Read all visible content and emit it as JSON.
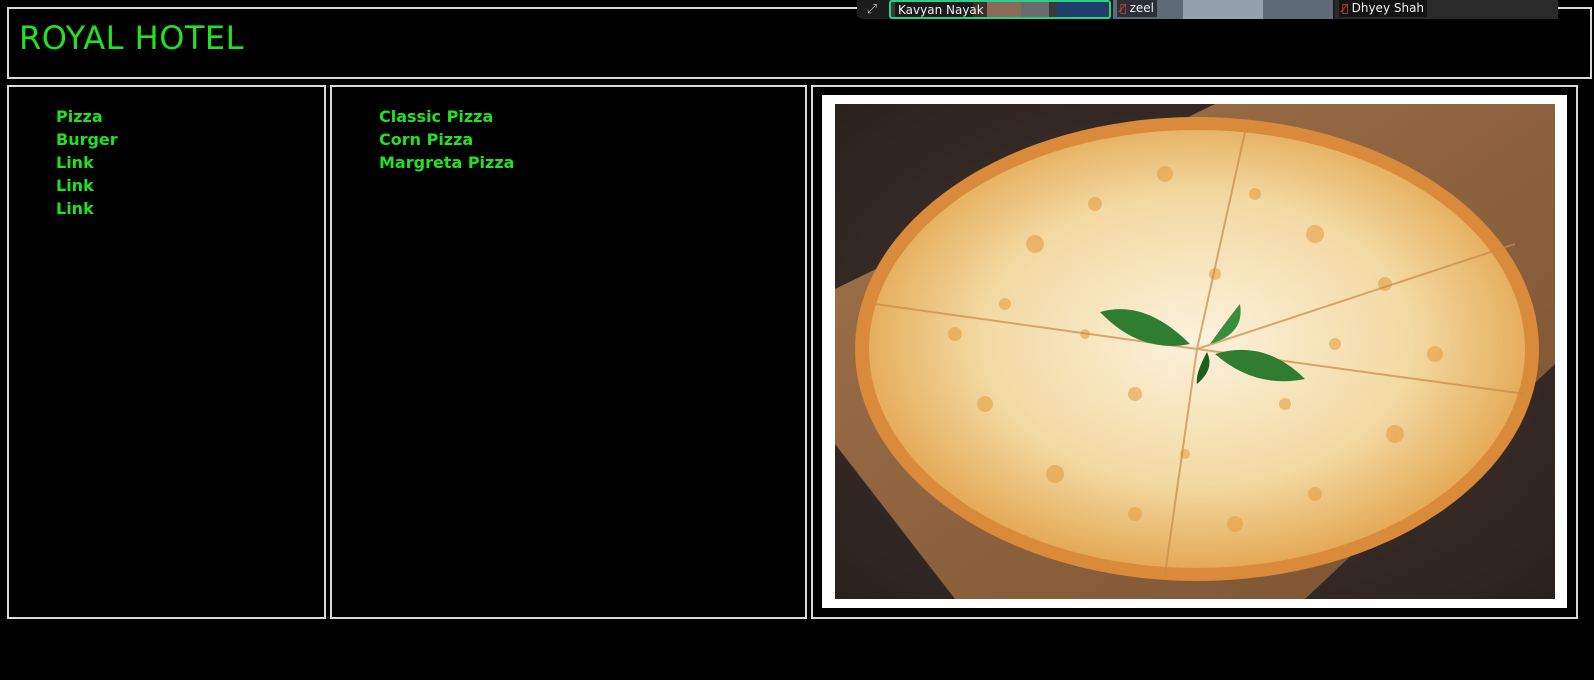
{
  "header": {
    "title": "ROYAL HOTEL"
  },
  "left_menu": {
    "items": [
      "Pizza",
      "Burger",
      "Link",
      "Link",
      "Link"
    ]
  },
  "mid_menu": {
    "items": [
      "Classic Pizza",
      "Corn Pizza",
      "Margreta Pizza"
    ]
  },
  "call": {
    "participants": [
      {
        "name": "Kavyan Nayak",
        "muted": false
      },
      {
        "name": "zeel",
        "muted": true
      },
      {
        "name": "Dhyey Shah",
        "muted": true
      }
    ]
  },
  "colors": {
    "accent": "#22e022",
    "border": "#d9d9d9",
    "background": "#000000",
    "active_speaker": "#23d18b"
  }
}
